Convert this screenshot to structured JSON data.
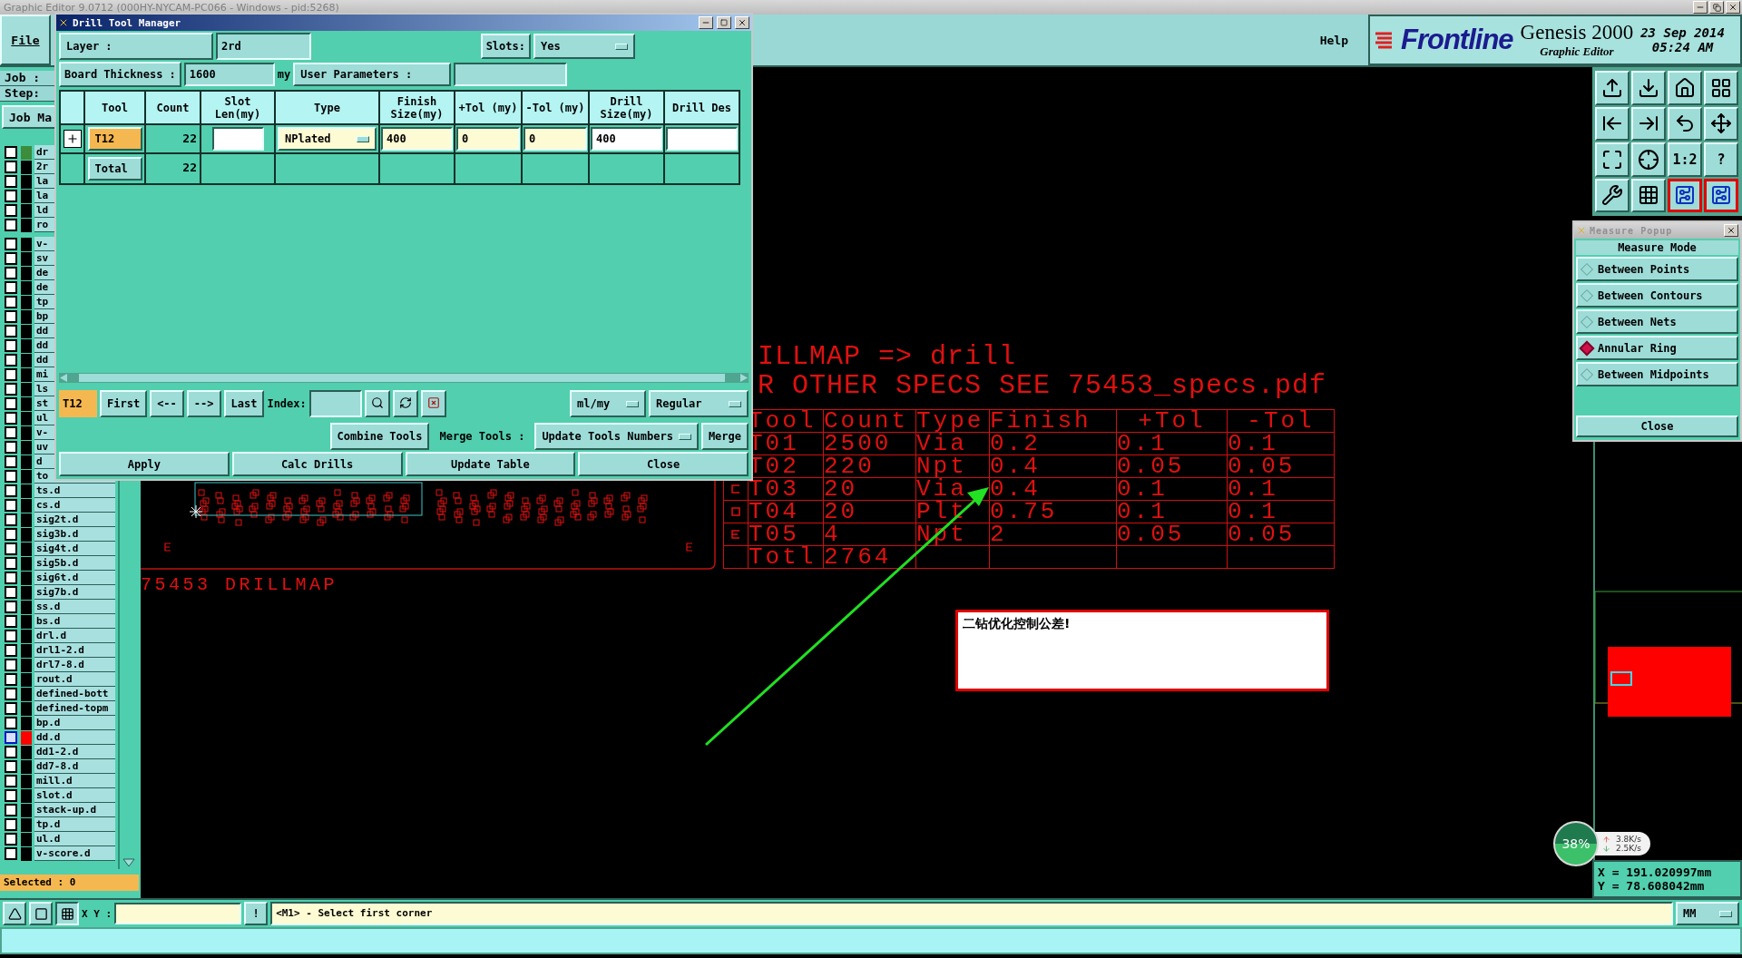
{
  "window": {
    "title": "Graphic Editor 9.0712 (000HY-NYCAM-PC066 - Windows - pid:5268)"
  },
  "menu": {
    "file": "File",
    "help": "Help"
  },
  "brand": {
    "logo": "Frontline",
    "product": "Genesis 2000",
    "subtitle": "Graphic Editor",
    "date": "23 Sep 2014",
    "time": "05:24 AM"
  },
  "job_panel": {
    "job_label": "Job :",
    "step_label": "Step:",
    "job_button": "Job Ma"
  },
  "layer_groups": [
    {
      "layers": [
        {
          "name": "dr",
          "color": "#3c8c3c",
          "affected": false
        },
        {
          "name": "2r",
          "color": "#000000",
          "affected": false
        },
        {
          "name": "la",
          "color": "#000000",
          "affected": false
        },
        {
          "name": "la",
          "color": "#000000",
          "affected": false
        },
        {
          "name": "ld",
          "color": "#000000",
          "affected": false
        },
        {
          "name": "ro",
          "color": "#000000",
          "affected": false
        }
      ]
    },
    {
      "layers": [
        {
          "name": "v-",
          "color": "#000000",
          "affected": false
        },
        {
          "name": "sv",
          "color": "#000000",
          "affected": false
        },
        {
          "name": "de",
          "color": "#000000",
          "affected": false
        },
        {
          "name": "de",
          "color": "#000000",
          "affected": false
        },
        {
          "name": "tp",
          "color": "#000000",
          "affected": false
        },
        {
          "name": "bp",
          "color": "#000000",
          "affected": false
        },
        {
          "name": "dd",
          "color": "#000000",
          "affected": false
        },
        {
          "name": "dd",
          "color": "#000000",
          "affected": false
        },
        {
          "name": "dd",
          "color": "#000000",
          "affected": false
        },
        {
          "name": "mi",
          "color": "#000000",
          "affected": false
        },
        {
          "name": "ls",
          "color": "#000000",
          "affected": false
        },
        {
          "name": "st",
          "color": "#000000",
          "affected": false
        },
        {
          "name": "ul",
          "color": "#000000",
          "affected": false
        },
        {
          "name": "v-",
          "color": "#000000",
          "affected": false
        },
        {
          "name": "uv",
          "color": "#000000",
          "affected": false
        },
        {
          "name": "d",
          "color": "#000000",
          "affected": false
        },
        {
          "name": "to",
          "color": "#000000",
          "affected": false
        },
        {
          "name": "ts.d",
          "color": "#000000",
          "affected": false
        },
        {
          "name": "cs.d",
          "color": "#000000",
          "affected": false
        },
        {
          "name": "sig2t.d",
          "color": "#000000",
          "affected": false
        },
        {
          "name": "sig3b.d",
          "color": "#000000",
          "affected": false
        },
        {
          "name": "sig4t.d",
          "color": "#000000",
          "affected": false
        },
        {
          "name": "sig5b.d",
          "color": "#000000",
          "affected": false
        },
        {
          "name": "sig6t.d",
          "color": "#000000",
          "affected": false
        },
        {
          "name": "sig7b.d",
          "color": "#000000",
          "affected": false
        },
        {
          "name": "ss.d",
          "color": "#000000",
          "affected": false
        },
        {
          "name": "bs.d",
          "color": "#000000",
          "affected": false
        },
        {
          "name": "drl.d",
          "color": "#000000",
          "affected": false
        },
        {
          "name": "drl1-2.d",
          "color": "#000000",
          "affected": false
        },
        {
          "name": "drl7-8.d",
          "color": "#000000",
          "affected": false
        },
        {
          "name": "rout.d",
          "color": "#000000",
          "affected": false
        },
        {
          "name": "defined-bott",
          "color": "#000000",
          "affected": false
        },
        {
          "name": "defined-topm",
          "color": "#000000",
          "affected": false
        },
        {
          "name": "bp.d",
          "color": "#000000",
          "affected": false
        },
        {
          "name": "dd.d",
          "color": "#ff0000",
          "affected": true
        },
        {
          "name": "dd1-2.d",
          "color": "#000000",
          "affected": false
        },
        {
          "name": "dd7-8.d",
          "color": "#000000",
          "affected": false
        },
        {
          "name": "mill.d",
          "color": "#000000",
          "affected": false
        },
        {
          "name": "slot.d",
          "color": "#000000",
          "affected": false
        },
        {
          "name": "stack-up.d",
          "color": "#000000",
          "affected": false
        },
        {
          "name": "tp.d",
          "color": "#000000",
          "affected": false
        },
        {
          "name": "ul.d",
          "color": "#000000",
          "affected": false
        },
        {
          "name": "v-score.d",
          "color": "#000000",
          "affected": false
        }
      ]
    }
  ],
  "selected_count": "Selected : 0",
  "drill_dialog": {
    "title": "Drill Tool Manager",
    "layer_label": "Layer :",
    "layer_value": "2rd",
    "slots_label": "Slots:",
    "slots_value": "Yes",
    "thickness_label": "Board Thickness :",
    "thickness_value": "1600",
    "thickness_unit": "my",
    "user_params_label": "User Parameters :",
    "columns": [
      "Tool",
      "Count",
      "Slot Len(my)",
      "Type",
      "Finish Size(my)",
      "+Tol (my)",
      "-Tol (my)",
      "Drill Size(my)",
      "Drill Des"
    ],
    "rows": [
      {
        "tool": "T12",
        "selected": true,
        "count": "22",
        "type": "NPlated",
        "finish": "400",
        "plus_tol": "0",
        "minus_tol": "0",
        "drill_size": "400"
      }
    ],
    "total": {
      "label": "Total",
      "count": "22"
    },
    "current_tool": "T12",
    "nav": [
      "First",
      "<--",
      "-->",
      "Last"
    ],
    "index_label": "Index:",
    "units": "ml/my",
    "mode": "Regular",
    "combine": "Combine Tools",
    "merge_label": "Merge Tools :",
    "merge_mode": "Update Tools Numbers",
    "merge": "Merge",
    "actions": [
      "Apply",
      "Calc Drills",
      "Update Table",
      "Close"
    ]
  },
  "drill_map": {
    "title_lines": [
      "ILLMAP => drill",
      "R OTHER SPECS SEE 75453_specs.pdf"
    ],
    "columns": [
      "Tool",
      "Count",
      "Type",
      "Finish",
      "+Tol",
      "-Tol"
    ],
    "rows": [
      {
        "kind": "plain",
        "cells": [
          "T01",
          "2500",
          "Via",
          "0.2",
          "0.1",
          "0.1"
        ]
      },
      {
        "kind": "plain",
        "cells": [
          "T02",
          "220",
          "Npt",
          "0.4",
          "0.05",
          "0.05"
        ]
      },
      {
        "kind": "bracket",
        "cells": [
          "T03",
          "20",
          "Via",
          "0.4",
          "0.1",
          "0.1"
        ]
      },
      {
        "kind": "square",
        "cells": [
          "T04",
          "20",
          "Plt",
          "0.75",
          "0.1",
          "0.1"
        ]
      },
      {
        "kind": "comb",
        "cells": [
          "T05",
          "4",
          "Npt",
          "2",
          "0.05",
          "0.05"
        ]
      },
      {
        "kind": "plain",
        "cells": [
          "Totl",
          "2764"
        ]
      }
    ],
    "caption": "75453  DRILLMAP",
    "note": "二钻优化控制公差!"
  },
  "toolbar": [
    {
      "kind": "icon",
      "on": false
    },
    {
      "kind": "icon",
      "on": false
    },
    {
      "kind": "icon",
      "on": false
    },
    {
      "kind": "icon",
      "on": false
    },
    {
      "kind": "icon",
      "on": false
    },
    {
      "kind": "icon",
      "on": false
    },
    {
      "kind": "icon",
      "on": false
    },
    {
      "kind": "icon",
      "on": false
    },
    {
      "kind": "icon",
      "on": false
    },
    {
      "kind": "icon",
      "on": false
    },
    {
      "kind": "text",
      "label": "1:2",
      "on": false
    },
    {
      "kind": "text",
      "label": "?",
      "on": false
    },
    {
      "kind": "icon",
      "on": false
    },
    {
      "kind": "icon",
      "on": false
    },
    {
      "kind": "icon",
      "on": true
    },
    {
      "kind": "icon",
      "on": true
    }
  ],
  "measure_popup": {
    "title": "Measure Popup",
    "heading": "Measure Mode",
    "options": [
      {
        "label": "Between Points",
        "selected": false
      },
      {
        "label": "Between Contours",
        "selected": false
      },
      {
        "label": "Between Nets",
        "selected": false
      },
      {
        "label": "Annular Ring",
        "selected": true
      },
      {
        "label": "Between Midpoints",
        "selected": false
      }
    ],
    "close": "Close"
  },
  "coordinates": {
    "x": "X = 191.020997mm",
    "y": "Y = 78.608042mm"
  },
  "network": {
    "load": "38%",
    "upload": "3.8K/s",
    "download": "2.5K/s"
  },
  "status_bar": {
    "tools": [
      {
        "selected": false
      },
      {
        "selected": false
      },
      {
        "selected": true
      }
    ],
    "xy_label": "X Y :",
    "alert": "!",
    "message": "<M1> - Select first corner",
    "units": "MM"
  }
}
